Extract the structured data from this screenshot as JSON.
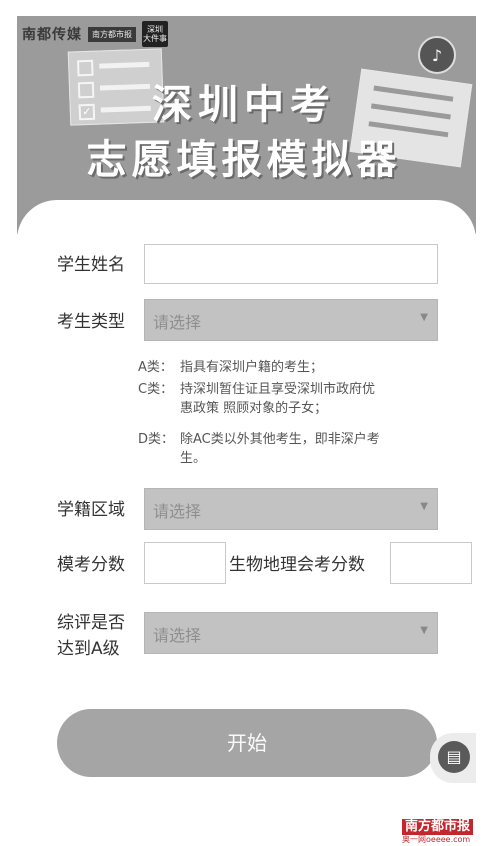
{
  "banner": {
    "logo_main": "南都传媒",
    "logo_sub": "南方都市报",
    "logo_badge": "深圳\n大件事",
    "title_line1": "深圳中考",
    "title_line2": "志愿填报模拟器",
    "music_icon": "music-note-icon"
  },
  "form": {
    "name_label": "学生姓名",
    "name_value": "",
    "type_label": "考生类型",
    "type_placeholder": "请选择",
    "type_notes": [
      {
        "tag": "A类：",
        "text": "指具有深圳户籍的考生；"
      },
      {
        "tag": "C类：",
        "text": "持深圳暂住证且享受深圳市政府优",
        "cont": "惠政策 照顾对象的子女；"
      },
      {
        "tag": "D类：",
        "text": "除AC类以外其他考生，即非深户考",
        "cont": "生。"
      }
    ],
    "region_label": "学籍区域",
    "region_placeholder": "请选择",
    "mock_label": "模考分数",
    "mock_value": "",
    "bio_geo_label": "生物地理会考分数",
    "bio_geo_value": "",
    "grade_label_line1": "综评是否",
    "grade_label_line2": "达到A级",
    "grade_placeholder": "请选择",
    "start_label": "开始"
  },
  "floating": {
    "icon": "document-icon"
  },
  "watermark": {
    "top": "南方都市报",
    "bottom": "奥一网oeeee.com"
  },
  "colors": {
    "banner_bg": "#9b9b9b",
    "select_bg": "#c2c2c2",
    "button_bg": "#a5a5a5",
    "watermark_red": "#c1272d"
  }
}
